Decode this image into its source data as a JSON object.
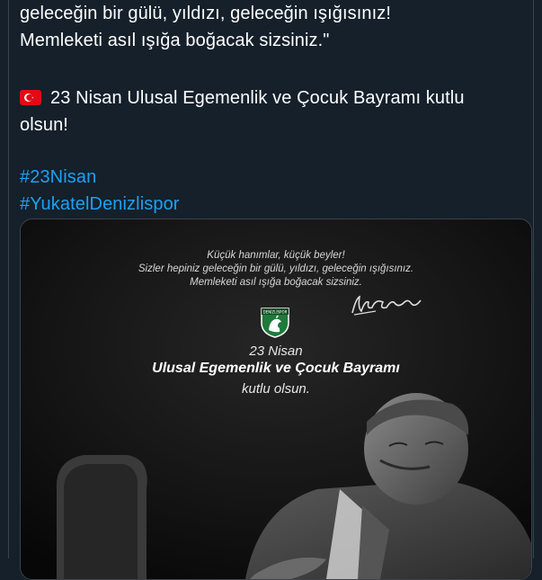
{
  "tweet": {
    "lines": [
      "geleceğin bir gülü, yıldızı, geleceğin ışığısınız!",
      "Memleketi asıl ışığa boğacak sizsiniz.\"",
      "23 Nisan Ulusal Egemenlik ve Çocuk Bayramı kutlu",
      "olsun!"
    ],
    "hashtags": [
      "#23Nisan",
      "#YukatelDenizlispor"
    ]
  },
  "media": {
    "quote_lines": [
      "Küçük hanımlar, küçük beyler!",
      "Sizler hepiniz geleceğin bir gülü, yıldızı, geleceğin ışığısınız.",
      "Memleketi asıl ışığa boğacak sizsiniz."
    ],
    "date": "23 Nisan",
    "title": "Ulusal Egemenlik ve Çocuk Bayramı",
    "subtitle": "kutlu olsun.",
    "crest_text": "DENİZLİSPOR"
  },
  "colors": {
    "background": "#15202b",
    "text": "#ffffff",
    "link": "#1da1f2",
    "border": "#38444d",
    "flag_red": "#e30a17",
    "crest_green": "#1e7a3a"
  },
  "icons": {
    "flag": "turkey-flag-icon",
    "crest": "denizlispor-crest-icon",
    "signature": "signature-icon"
  }
}
